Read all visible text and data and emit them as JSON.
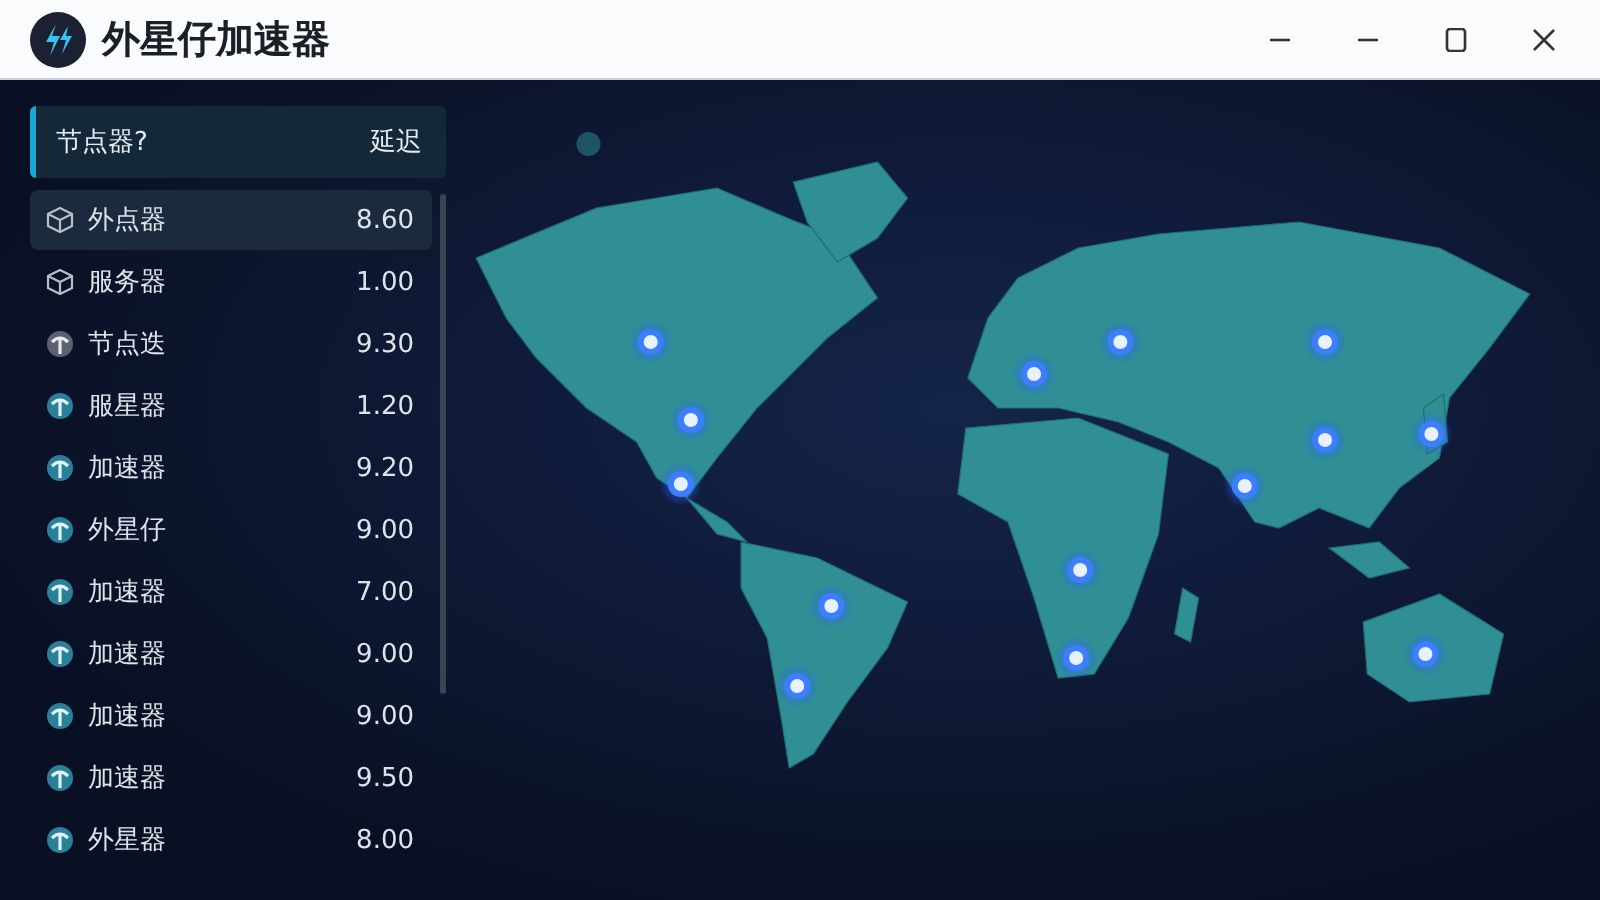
{
  "window": {
    "title": "外星仔加速器"
  },
  "list_header": {
    "name": "节点器?",
    "latency": "延迟"
  },
  "nodes": [
    {
      "name": "外点器",
      "latency": "8.60",
      "kind": "cube",
      "selected": true
    },
    {
      "name": "服务器",
      "latency": "1.00",
      "kind": "cube",
      "selected": false
    },
    {
      "name": "节点迭",
      "latency": "9.30",
      "kind": "node",
      "selected": false
    },
    {
      "name": "服星器",
      "latency": "1.20",
      "kind": "globe",
      "selected": false
    },
    {
      "name": "加速器",
      "latency": "9.20",
      "kind": "globe",
      "selected": false
    },
    {
      "name": "外星仔",
      "latency": "9.00",
      "kind": "globe",
      "selected": false
    },
    {
      "name": "加速器",
      "latency": "7.00",
      "kind": "globe",
      "selected": false
    },
    {
      "name": "加速器",
      "latency": "9.00",
      "kind": "globe",
      "selected": false
    },
    {
      "name": "加速器",
      "latency": "9.00",
      "kind": "globe",
      "selected": false
    },
    {
      "name": "加速器",
      "latency": "9.50",
      "kind": "globe",
      "selected": false
    },
    {
      "name": "外星器",
      "latency": "8.00",
      "kind": "globe",
      "selected": false
    }
  ]
}
